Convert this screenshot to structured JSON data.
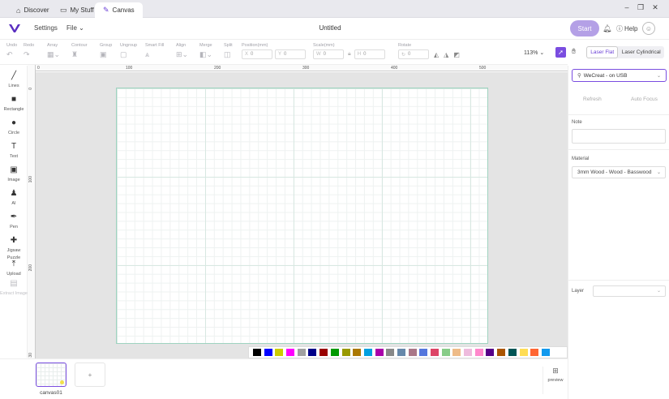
{
  "tabs": [
    {
      "label": "Discover",
      "icon": "home-icon"
    },
    {
      "label": "My Stuff",
      "icon": "monitor-icon"
    },
    {
      "label": "Canvas",
      "icon": "pen-icon"
    }
  ],
  "header": {
    "settings": "Settings",
    "file": "File",
    "title": "Untitled",
    "start": "Start",
    "help": "Help"
  },
  "toolbar": {
    "undo": "Undo",
    "redo": "Redo",
    "array": "Array",
    "contour": "Contour",
    "group": "Group",
    "ungroup": "Ungroup",
    "smart_fill": "Smart Fill",
    "align": "Align",
    "merge": "Merge",
    "split": "Split",
    "position": "Position(mm)",
    "pos_x_label": "X",
    "pos_x": "0",
    "pos_y_label": "Y",
    "pos_y": "0",
    "scale": "Scale(mm)",
    "scale_w_label": "W",
    "scale_w": "0",
    "scale_h_label": "H",
    "scale_h": "0",
    "rotate": "Rotate",
    "rotate_val": "0",
    "zoom": "113%"
  },
  "modes": {
    "flat": "Laser Flat",
    "cylindrical": "Laser Cylindrical"
  },
  "left_tools": [
    {
      "label": "Lines",
      "icon": "line-icon",
      "sym": "╱",
      "enabled": true
    },
    {
      "label": "Rectangle",
      "icon": "rectangle-icon",
      "sym": "■",
      "enabled": true
    },
    {
      "label": "Circle",
      "icon": "circle-icon",
      "sym": "●",
      "enabled": true
    },
    {
      "label": "Text",
      "icon": "text-icon",
      "sym": "T",
      "enabled": true
    },
    {
      "label": "Image",
      "icon": "image-icon",
      "sym": "▣",
      "enabled": true
    },
    {
      "label": "AI",
      "icon": "ai-icon",
      "sym": "♟",
      "enabled": true
    },
    {
      "label": "Pen",
      "icon": "pen-tool-icon",
      "sym": "✒",
      "enabled": true
    },
    {
      "label": "Jigsaw Puzzle",
      "icon": "puzzle-icon",
      "sym": "✚",
      "enabled": true
    },
    {
      "label": "Upload",
      "icon": "upload-icon",
      "sym": "⤒",
      "enabled": true
    },
    {
      "label": "Extract Image",
      "icon": "extract-image-icon",
      "sym": "▤",
      "enabled": false
    }
  ],
  "ruler_x": [
    "0",
    "100",
    "200",
    "300",
    "400",
    "500"
  ],
  "ruler_y": [
    "0",
    "100",
    "200",
    "30"
  ],
  "palette": [
    "#000000",
    "#0000ff",
    "#cccc00",
    "#ff00ff",
    "#a0a0a0",
    "#000088",
    "#990000",
    "#009900",
    "#999900",
    "#aa7700",
    "#00a0e0",
    "#aa00aa",
    "#888888",
    "#6688aa",
    "#aa7788",
    "#5577dd",
    "#dd4466",
    "#88cc88",
    "#eebb88",
    "#eebbdd",
    "#ff88cc",
    "#550088",
    "#aa5500",
    "#005555",
    "#ffdd55",
    "#ff6633",
    "#1199ee"
  ],
  "canvas_tab": {
    "label": "canvas01",
    "add": "+"
  },
  "preview": "preview",
  "right": {
    "device": "WeCreat - on USB",
    "refresh": "Refresh",
    "autofocus": "Auto Focus",
    "note_label": "Note",
    "material_label": "Material",
    "material": "3mm Wood - Wood - Basswood",
    "layer_label": "Layer"
  }
}
